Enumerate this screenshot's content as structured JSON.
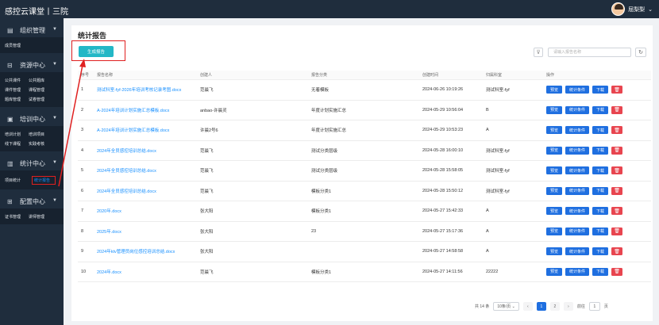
{
  "app": {
    "title": "感控云课堂丨三院",
    "user_name": "屈梨梨"
  },
  "sidebar": {
    "sections": [
      {
        "label": "组织管理",
        "icon": "org-icon",
        "rows": [
          [
            "成员管理"
          ]
        ]
      },
      {
        "label": "资源中心",
        "icon": "resource-icon",
        "rows": [
          [
            "公共课件",
            "公共题库"
          ],
          [
            "课件管理",
            "课程管理"
          ],
          [
            "题库管理",
            "试卷管理"
          ]
        ]
      },
      {
        "label": "培训中心",
        "icon": "training-icon",
        "rows": [
          [
            "培训计划",
            "培训项目"
          ],
          [
            "线下课程",
            "实践考核"
          ]
        ]
      },
      {
        "label": "统计中心",
        "icon": "stats-icon",
        "rows": [
          [
            "项目统计",
            "统计报告"
          ]
        ]
      },
      {
        "label": "配置中心",
        "icon": "config-icon",
        "rows": [
          [
            "证书管理",
            "讲师管理"
          ]
        ]
      }
    ]
  },
  "page": {
    "title": "统计报告",
    "generate_button": "生成报告",
    "search_placeholder": "请输入报告名称"
  },
  "table": {
    "headers": [
      "序号",
      "报告名称",
      "创建人",
      "报告分类",
      "创建时间",
      "归属科室",
      "操作"
    ],
    "ops": {
      "preview": "预览",
      "conditions": "统计条件",
      "download": "下载",
      "delete_icon": "🗑"
    },
    "rows": [
      {
        "idx": "1",
        "name": "测试科室-fyf-2026年培训考核记录考图.docx",
        "creator": "范晨飞",
        "category": "无着模板",
        "time": "2024-06-26 10:19:26",
        "dept": "测试科室-fyf"
      },
      {
        "idx": "2",
        "name": "A-2024年培训计划实施汇总模板.docx",
        "creator": "anbao-许晨灵",
        "category": "年度计划实施汇总",
        "time": "2024-05-29 10:56:04",
        "dept": "B"
      },
      {
        "idx": "3",
        "name": "A-2024年培训计划实施汇总模板.docx",
        "creator": "许晨2号6",
        "category": "年度计划实施汇总",
        "time": "2024-05-29 10:53:23",
        "dept": "A"
      },
      {
        "idx": "4",
        "name": "2024年全员感控培训总结.docx",
        "creator": "范晨飞",
        "category": "测试分类层级",
        "time": "2024-05-28 16:00:10",
        "dept": "测试科室-fyf"
      },
      {
        "idx": "5",
        "name": "2024年全员感控培训总结.docx",
        "creator": "范晨飞",
        "category": "测试分类层级",
        "time": "2024-05-28 15:58:05",
        "dept": "测试科室-fyf"
      },
      {
        "idx": "6",
        "name": "2024年全员感控培训总结.docx",
        "creator": "范晨飞",
        "category": "模板分类1",
        "time": "2024-05-28 15:50:12",
        "dept": "测试科室-fyf"
      },
      {
        "idx": "7",
        "name": "2020年.docx",
        "creator": "张大阳",
        "category": "模板分类1",
        "time": "2024-05-27 15:42:33",
        "dept": "A"
      },
      {
        "idx": "8",
        "name": "2025年.docx",
        "creator": "张大阳",
        "category": "23",
        "time": "2024-05-27 15:17:36",
        "dept": "A"
      },
      {
        "idx": "9",
        "name": "2024年ktv管理员岗位感控培训总结.docx",
        "creator": "张大阳",
        "category": "",
        "time": "2024-05-27 14:58:58",
        "dept": "A"
      },
      {
        "idx": "10",
        "name": "2024年.docx",
        "creator": "范晨飞",
        "category": "模板分类1",
        "time": "2024-05-27 14:11:56",
        "dept": "22222"
      }
    ]
  },
  "pagination": {
    "total": "共 14 条",
    "page_size": "10条/页",
    "pages": [
      "1",
      "2"
    ],
    "current": "1",
    "goto_label": "前往",
    "goto_value": "1",
    "goto_suffix": "页"
  }
}
